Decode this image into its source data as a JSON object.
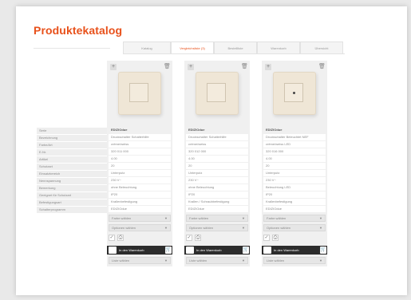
{
  "page": {
    "title": "Produktekatalog"
  },
  "tabs": [
    {
      "label": "Katalog"
    },
    {
      "label": "Vergleichsliste (3)"
    },
    {
      "label": "Bestellliste"
    },
    {
      "label": "Warenkorb"
    },
    {
      "label": "Übersicht"
    }
  ],
  "row_labels": [
    "Serie",
    "Bezeichnung",
    "Farbe/Art",
    "E-Nr.",
    "Artikel",
    "Schutzart",
    "Einsatzbereich",
    "Nennspannung",
    "Bemerkung",
    "Geeignet für Schutzart",
    "Befestigungsart",
    "Schalterprogramm"
  ],
  "products": [
    {
      "values": [
        "EDIZIOdue",
        "Druckschalter Schalterhilfe",
        "crème/weiss",
        "320 011 000",
        "4.00",
        "20",
        "Unterputz",
        "230 V~",
        "ohne Beleuchtung",
        "IP20",
        "Krallenbefestigung",
        "EDIZIOdue"
      ],
      "select1": "Farbe wählen",
      "select2": "Optionen wählen",
      "cart_label": "In den Warenkorb",
      "bottom_select": "Liste wählen",
      "has_dot": false
    },
    {
      "values": [
        "EDIZIOdue",
        "Druckschalter Schalterhilfe",
        "crème/weiss",
        "320 012 000",
        "4.00",
        "20",
        "Unterputz",
        "230 V~",
        "ohne Beleuchtung",
        "IP20",
        "Krallen / Schraubbefestigung",
        "EDIZIOdue"
      ],
      "select1": "Farbe wählen",
      "select2": "Optionen wählen",
      "cart_label": "In den Warenkorb",
      "bottom_select": "Liste wählen",
      "has_dot": false
    },
    {
      "values": [
        "EDIZIOdue",
        "Druckschalter Beleuchtet NEF",
        "crème/weiss LED",
        "320 016 000",
        "4.00",
        "20",
        "Unterputz",
        "230 V~",
        "Beleuchtung LED",
        "IP20",
        "Krallenbefestigung",
        "EDIZIOdue"
      ],
      "select1": "Farbe wählen",
      "select2": "Optionen wählen",
      "cart_label": "In den Warenkorb",
      "bottom_select": "Liste wählen",
      "has_dot": true
    }
  ],
  "colors": {
    "accent": "#e8511b",
    "cart_bg": "#2c2c2c",
    "switch_beige": "#efe6d6"
  },
  "icons": {
    "add": "plus-icon",
    "remove": "trash-icon",
    "check": "check-icon",
    "print": "print-icon",
    "cart": "cart-icon",
    "dropdown": "chevron-down-icon"
  }
}
